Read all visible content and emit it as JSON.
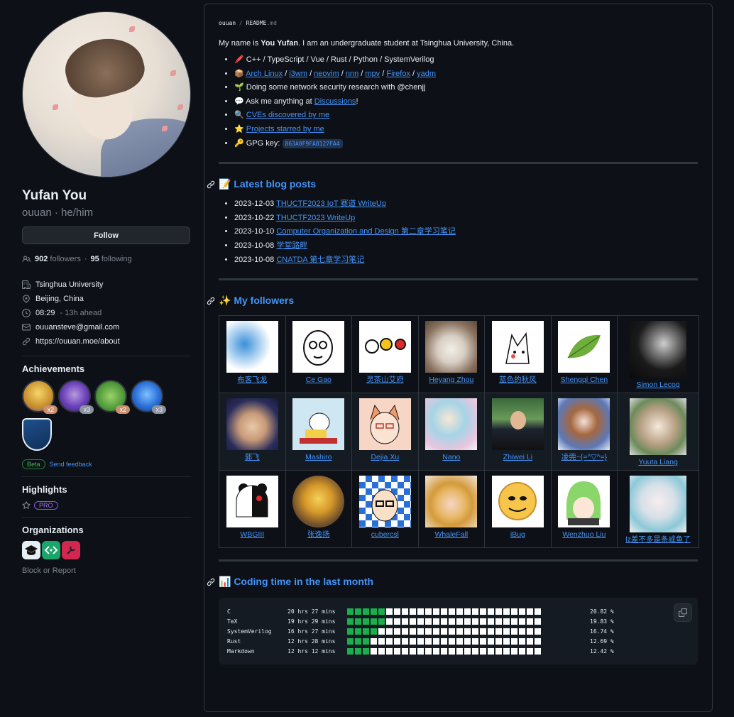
{
  "profile": {
    "fullname": "Yufan You",
    "login": "ouuan · he/him",
    "follow_label": "Follow",
    "followers_count": "902",
    "followers_label": "followers",
    "dot": "·",
    "following_count": "95",
    "following_label": "following",
    "details": [
      {
        "icon": "building-icon",
        "text": "Tsinghua University",
        "muted": ""
      },
      {
        "icon": "location-icon",
        "text": "Beijing, China",
        "muted": ""
      },
      {
        "icon": "clock-icon",
        "text": "08:29",
        "muted": "- 13h ahead"
      },
      {
        "icon": "mail-icon",
        "text": "ouuansteve@gmail.com",
        "muted": ""
      },
      {
        "icon": "link-icon",
        "text": "https://ouuan.moe/about",
        "muted": ""
      }
    ],
    "achievements_title": "Achievements",
    "achievements": [
      {
        "name": "achievement-badge-1",
        "count": "x2"
      },
      {
        "name": "achievement-badge-2",
        "count": "x3"
      },
      {
        "name": "achievement-badge-3",
        "count": "x2"
      },
      {
        "name": "achievement-badge-4",
        "count": "x3"
      }
    ],
    "beta_label": "Beta",
    "feedback_label": "Send feedback",
    "highlights_title": "Highlights",
    "pro_label": "PRO",
    "organizations_title": "Organizations",
    "block_label": "Block or Report"
  },
  "readme": {
    "crumb_owner": "ouuan",
    "crumb_sep": "/",
    "crumb_file": "README",
    "crumb_ext": ".md",
    "intro_prefix": "My name is ",
    "intro_name": "You Yufan",
    "intro_suffix": ". I am an undergraduate student at Tsinghua University, China.",
    "items": {
      "langs": "🖍️ C++ / TypeScript / Vue / Rust / Python / SystemVerilog",
      "tools_emoji": "📦",
      "tools": [
        "Arch Linux",
        "i3wm",
        "neovim",
        "nnn",
        "mpv",
        "Firefox",
        "yadm"
      ],
      "tools_sep": "/",
      "research": "🌱 Doing some network security research with @chenjj",
      "ask_prefix": "💬 Ask me anything at ",
      "ask_link": "Discussions",
      "ask_suffix": "!",
      "cves_emoji": "🔍",
      "cves_link": "CVEs discovered by me",
      "projects_emoji": "⭐",
      "projects_link": "Projects starred by me",
      "gpg_prefix": "🔑 GPG key: ",
      "gpg_key": "863A0F9FA8127FA4"
    },
    "blog_title": "📝 Latest blog posts",
    "posts": [
      {
        "date": "2023-12-03",
        "title": "THUCTF2023 IoT 赛道 WriteUp"
      },
      {
        "date": "2023-10-22",
        "title": "THUCTF2023 WriteUp"
      },
      {
        "date": "2023-10-10",
        "title": "Computer Organization and Design 第二章学习笔记"
      },
      {
        "date": "2023-10-08",
        "title": "学堂路畔"
      },
      {
        "date": "2023-10-08",
        "title": "CNATDA 第七章学习笔记"
      }
    ],
    "followers_title": "✨ My followers",
    "followers": [
      [
        "布客飞龙",
        "Ce Gao",
        "灵茶山艾府",
        "Heyang Zhou",
        "蓝色的秋风",
        "Shengqi Chen",
        "Simon Lecog"
      ],
      [
        "郭飞",
        "Mashiro",
        "Dejia Xu",
        "Nano",
        "Zhiwei Li",
        "凌莞~{=^▽^=}",
        "Yuuta Liang"
      ],
      [
        "WBGIII",
        "张逸扬",
        "cubercsl",
        "WhaleFall",
        "iBug",
        "Wenzhuo Liu",
        "lz差不多是条咸鱼了"
      ]
    ],
    "coding_title": "📊 Coding time in the last month",
    "coding": [
      {
        "lang": "C",
        "time": "20 hrs 27 mins",
        "pct": "20.82 %",
        "fill": 0.2082
      },
      {
        "lang": "TeX",
        "time": "19 hrs 29 mins",
        "pct": "19.83 %",
        "fill": 0.1983
      },
      {
        "lang": "SystemVerilog",
        "time": "16 hrs 27 mins",
        "pct": "16.74 %",
        "fill": 0.1674
      },
      {
        "lang": "Rust",
        "time": "12 hrs 28 mins",
        "pct": "12.69 %",
        "fill": 0.1269
      },
      {
        "lang": "Markdown",
        "time": "12 hrs 12 mins",
        "pct": "12.42 %",
        "fill": 0.1242
      }
    ]
  },
  "colors": {
    "link": "#4493f8",
    "bg": "#0d1117",
    "bar_on": "#1aae4c",
    "bar_off": "#ffffff"
  }
}
